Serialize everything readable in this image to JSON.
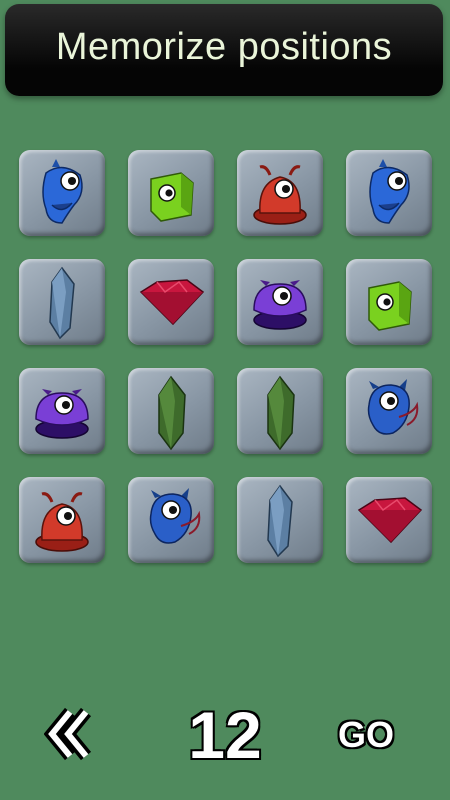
{
  "header": {
    "title": "Memorize positions"
  },
  "grid": {
    "rows": 4,
    "cols": 4,
    "tiles": [
      "blue-creature-icon",
      "green-cube-creature-icon",
      "red-antenna-creature-icon",
      "blue-creature-icon",
      "blue-crystal-icon",
      "red-gem-icon",
      "purple-creature-icon",
      "green-cube-creature-icon",
      "purple-creature-icon",
      "green-crystal-icon",
      "green-crystal-icon",
      "blue-bomb-creature-icon",
      "red-antenna-creature-icon",
      "blue-bomb-creature-icon",
      "blue-crystal-icon",
      "red-gem-icon"
    ]
  },
  "controls": {
    "back_icon": "double-chevron-left-icon",
    "timer_value": "12",
    "go_label": "GO"
  },
  "colors": {
    "background": "#4f8a5d",
    "tile": "#8c99a7",
    "title_text": "#eaf5d9"
  }
}
